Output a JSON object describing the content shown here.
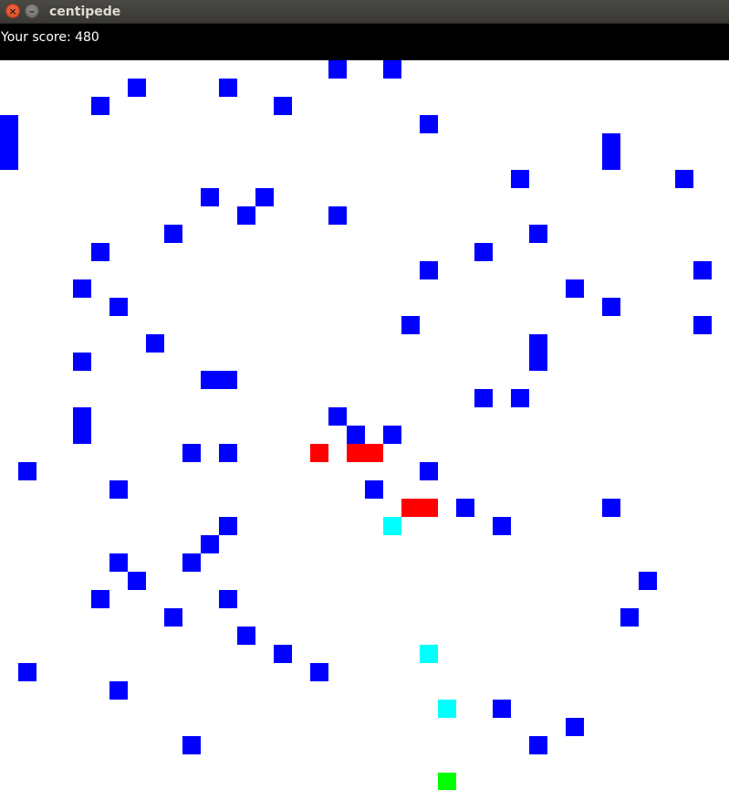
{
  "window": {
    "title": "centipede"
  },
  "titlebar": {
    "close_glyph": "×",
    "minimize_glyph": "–"
  },
  "score": {
    "text": "Your score: 480"
  },
  "colors": {
    "mushroom": "#0000ff",
    "centipede": "#ff0000",
    "spider": "#00ffff",
    "player": "#00ff00"
  },
  "game": {
    "mushrooms": [
      [
        18,
        0
      ],
      [
        21,
        0
      ],
      [
        7,
        1
      ],
      [
        12,
        1
      ],
      [
        5,
        2
      ],
      [
        15,
        2
      ],
      [
        0,
        3
      ],
      [
        23,
        3
      ],
      [
        0,
        4
      ],
      [
        33,
        4
      ],
      [
        0,
        5
      ],
      [
        33,
        5
      ],
      [
        28,
        6
      ],
      [
        37,
        6
      ],
      [
        11,
        7
      ],
      [
        14,
        7
      ],
      [
        13,
        8
      ],
      [
        18,
        8
      ],
      [
        9,
        9
      ],
      [
        29,
        9
      ],
      [
        5,
        10
      ],
      [
        26,
        10
      ],
      [
        23,
        11
      ],
      [
        38,
        11
      ],
      [
        4,
        12
      ],
      [
        31,
        12
      ],
      [
        6,
        13
      ],
      [
        33,
        13
      ],
      [
        22,
        14
      ],
      [
        38,
        14
      ],
      [
        8,
        15
      ],
      [
        29,
        15
      ],
      [
        4,
        16
      ],
      [
        29,
        16
      ],
      [
        11,
        17
      ],
      [
        12,
        17
      ],
      [
        26,
        18
      ],
      [
        28,
        18
      ],
      [
        4,
        19
      ],
      [
        18,
        19
      ],
      [
        4,
        20
      ],
      [
        19,
        20
      ],
      [
        21,
        20
      ],
      [
        10,
        21
      ],
      [
        12,
        21
      ],
      [
        1,
        22
      ],
      [
        23,
        22
      ],
      [
        6,
        23
      ],
      [
        20,
        23
      ],
      [
        25,
        24
      ],
      [
        33,
        24
      ],
      [
        12,
        25
      ],
      [
        27,
        25
      ],
      [
        11,
        26
      ],
      [
        6,
        27
      ],
      [
        10,
        27
      ],
      [
        7,
        28
      ],
      [
        35,
        28
      ],
      [
        5,
        29
      ],
      [
        12,
        29
      ],
      [
        9,
        30
      ],
      [
        34,
        30
      ],
      [
        13,
        31
      ],
      [
        15,
        32
      ],
      [
        1,
        33
      ],
      [
        17,
        33
      ],
      [
        6,
        34
      ],
      [
        27,
        35
      ],
      [
        31,
        36
      ],
      [
        10,
        37
      ],
      [
        29,
        37
      ]
    ],
    "centipede_segments": [
      [
        17,
        21
      ],
      [
        19,
        21
      ],
      [
        20,
        21
      ],
      [
        22,
        24
      ],
      [
        23,
        24
      ]
    ],
    "spiders": [
      [
        21,
        25
      ],
      [
        23,
        32
      ],
      [
        24,
        35
      ]
    ],
    "player": [
      24,
      39
    ]
  }
}
